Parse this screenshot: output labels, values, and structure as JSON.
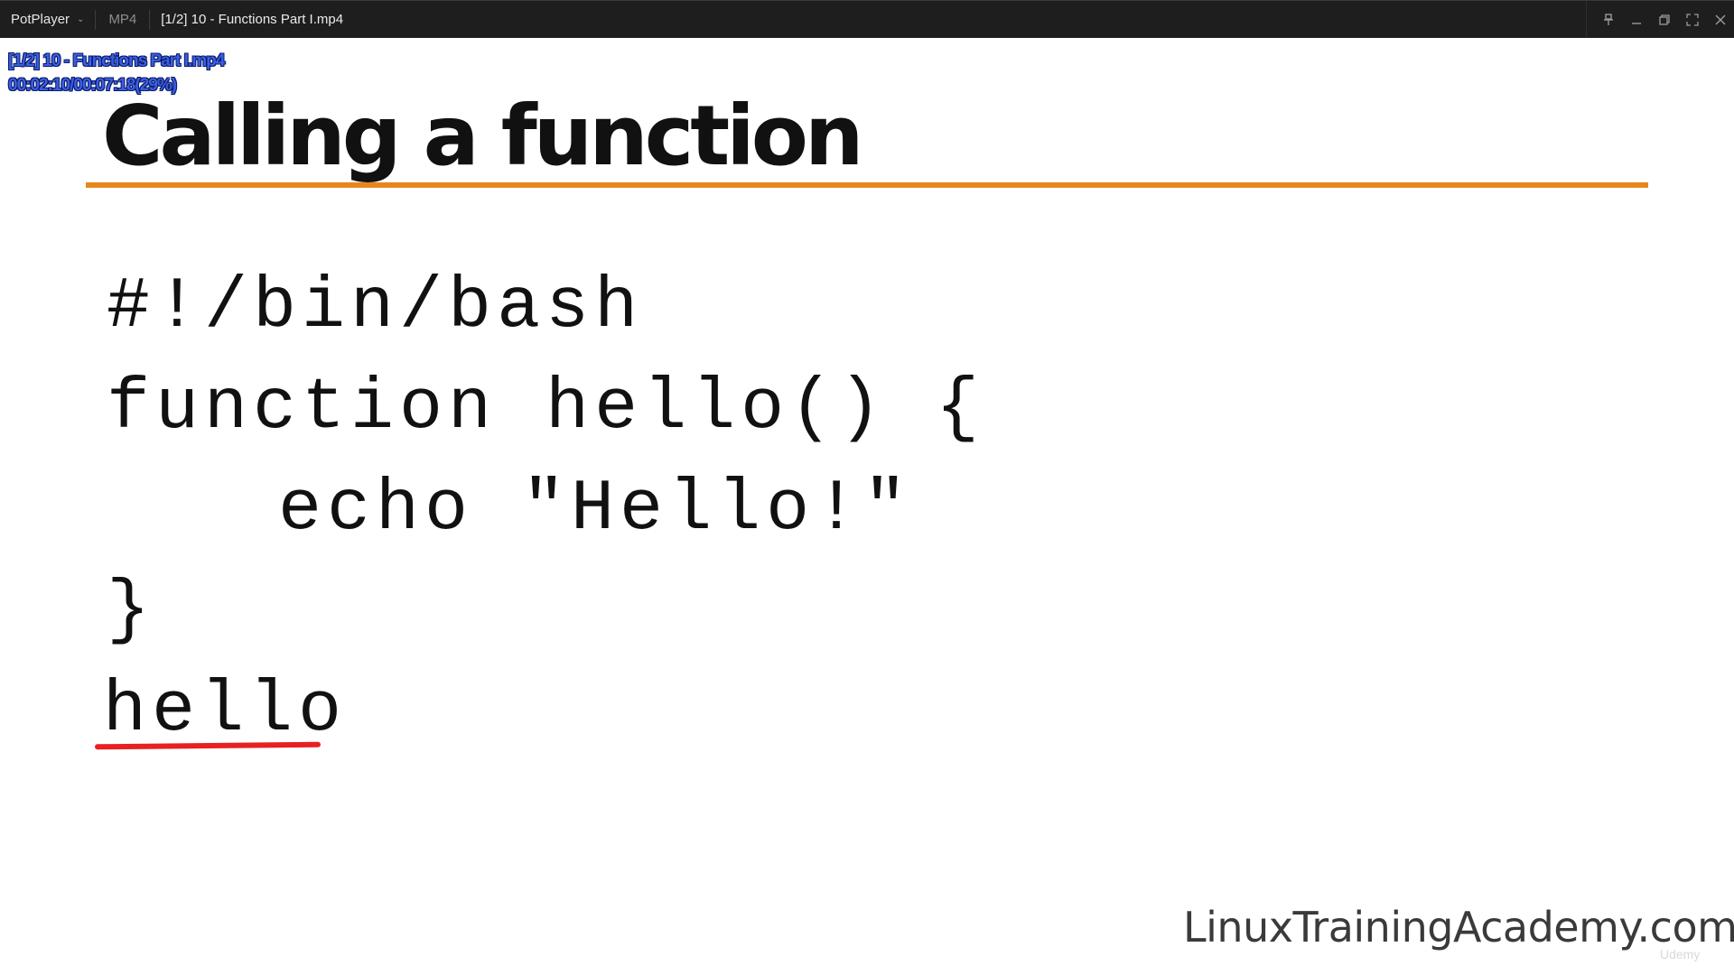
{
  "titlebar": {
    "app_name": "PotPlayer",
    "format": "MP4",
    "file_title": "[1/2] 10 - Functions Part I.mp4"
  },
  "osd": {
    "filename": "[1/2] 10 - Functions Part I.mp4",
    "time": "00:02:10/00:07:18(29%)"
  },
  "slide": {
    "title": "Calling a function",
    "code": [
      "#!/bin/bash",
      "function hello() {",
      "echo \"Hello!\"",
      "}",
      "hello"
    ],
    "watermark": "LinuxTrainingAcademy.com",
    "logo": "Udemy"
  },
  "colors": {
    "title_rule": "#e8861c",
    "underline": "#e82020",
    "osd_text": "#3b5fe0",
    "titlebar_bg": "#1e1e1e"
  }
}
